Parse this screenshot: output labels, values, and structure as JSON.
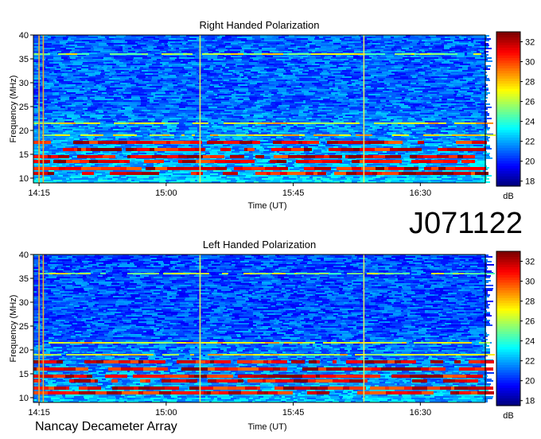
{
  "figure": {
    "observation_id": "J071122",
    "instrument": "Nancay Decameter Array"
  },
  "chart_data": [
    {
      "type": "heatmap",
      "title": "Right Handed Polarization",
      "xlabel": "Time (UT)",
      "ylabel": "Frequency (MHz)",
      "x_ticks": [
        "14:15",
        "15:00",
        "15:45",
        "16:30"
      ],
      "x_tick_minutes": [
        855,
        900,
        945,
        990
      ],
      "xlim_minutes": [
        853,
        1013
      ],
      "y_ticks": [
        10,
        15,
        20,
        25,
        30,
        35,
        40
      ],
      "ylim": [
        9,
        40
      ],
      "colorbar": {
        "label": "dB",
        "ticks": [
          18,
          20,
          22,
          24,
          26,
          28,
          30,
          32
        ],
        "range": [
          17.5,
          33
        ]
      },
      "bright_frequencies_mhz": [
        11,
        12,
        13.5,
        14.5,
        16,
        17.5,
        19,
        21.5,
        36
      ],
      "vertical_lines_minutes": [
        855,
        856.5,
        912,
        970
      ]
    },
    {
      "type": "heatmap",
      "title": "Left Handed Polarization",
      "xlabel": "Time (UT)",
      "ylabel": "Frequency (MHz)",
      "x_ticks": [
        "14:15",
        "15:00",
        "15:45",
        "16:30"
      ],
      "x_tick_minutes": [
        855,
        900,
        945,
        990
      ],
      "xlim_minutes": [
        853,
        1013
      ],
      "y_ticks": [
        10,
        15,
        20,
        25,
        30,
        35,
        40
      ],
      "ylim": [
        9,
        40
      ],
      "colorbar": {
        "label": "dB",
        "ticks": [
          18,
          20,
          22,
          24,
          26,
          28,
          30,
          32
        ],
        "range": [
          17.5,
          33
        ]
      },
      "bright_frequencies_mhz": [
        11,
        12,
        13.5,
        14.5,
        16,
        17.5,
        19,
        21.5,
        36
      ],
      "vertical_lines_minutes": [
        855,
        856.5,
        912,
        970
      ]
    }
  ]
}
